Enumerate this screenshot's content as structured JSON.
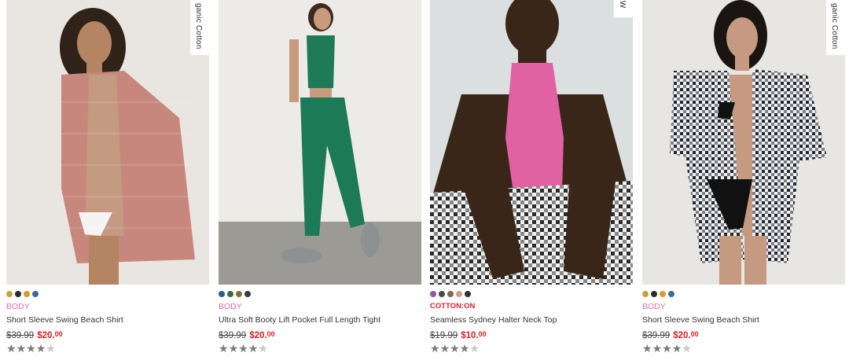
{
  "products": [
    {
      "tag": "ganic Cotton",
      "swatches": [
        "#c9a040",
        "#2b2b2b",
        "#d99a2b",
        "#3b6aa0"
      ],
      "brand": "BODY",
      "name": "Short Sleeve Swing Beach Shirt",
      "was_price": "$39.99",
      "now_dollars": "$20.",
      "now_cents": "00",
      "rating": 4
    },
    {
      "tag": "",
      "swatches": [
        "#2f5d8a",
        "#3e6b3d",
        "#8a6a3c",
        "#3b3b3b"
      ],
      "brand": "BODY",
      "name": "Ultra Soft Booty Lift Pocket Full Length Tight",
      "was_price": "$39.99",
      "now_dollars": "$20.",
      "now_cents": "00",
      "rating": 4
    },
    {
      "tag": "EW",
      "swatches": [
        "#8b5aa8",
        "#4a4a4a",
        "#7a6a56",
        "#c8a088",
        "#333333"
      ],
      "brand": "COTTON:ON",
      "name": "Seamless Sydney Halter Neck Top",
      "was_price": "$19.99",
      "now_dollars": "$10.",
      "now_cents": "00",
      "rating": 4
    },
    {
      "tag": "ganic Cotton",
      "swatches": [
        "#c9a040",
        "#2b2b2b",
        "#d99a2b",
        "#3b6aa0"
      ],
      "brand": "BODY",
      "name": "Short Sleeve Swing Beach Shirt",
      "was_price": "$39.99",
      "now_dollars": "$20.",
      "now_cents": "00",
      "rating": 4
    }
  ]
}
